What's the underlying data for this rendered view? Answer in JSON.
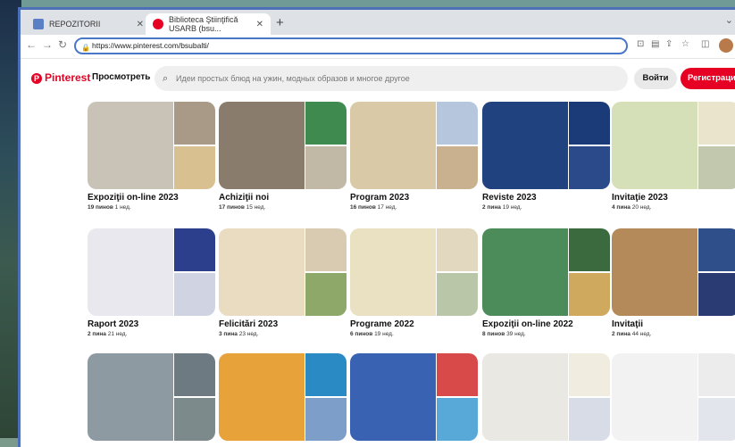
{
  "browser": {
    "tabs": [
      {
        "label": "REPOZITORII",
        "active": false
      },
      {
        "label": "Biblioteca Ştiinţifică USARB (bsu...",
        "active": true
      }
    ],
    "new_tab": "+",
    "window_control": "⌄",
    "url": "https://www.pinterest.com/bsubalti/"
  },
  "pinterest": {
    "logo_text": "Pinterest",
    "view_label": "Просмотреть",
    "search_placeholder": "Идеи простых блюд на ужин, модных образов и многое другое",
    "login_label": "Войти",
    "signup_label": "Регистрация"
  },
  "boards": [
    {
      "title": "Expoziţii on-line 2023",
      "pins": "19 пинов",
      "age": "1 нед.",
      "colors": [
        "#c9c2b6",
        "#a89a86",
        "#d8c090"
      ]
    },
    {
      "title": "Achiziţii noi",
      "pins": "17 пинов",
      "age": "15 нед.",
      "colors": [
        "#8a7c6c",
        "#3f8a4e",
        "#c2b8a6"
      ]
    },
    {
      "title": "Program 2023",
      "pins": "16 пинов",
      "age": "17 нед.",
      "colors": [
        "#d9c9a6",
        "#b6c6dc",
        "#c9b08e"
      ]
    },
    {
      "title": "Reviste 2023",
      "pins": "2 пина",
      "age": "19 нед.",
      "colors": [
        "#20427f",
        "#1b3a78",
        "#2a4a8a"
      ]
    },
    {
      "title": "Invitaţie 2023",
      "pins": "4 пина",
      "age": "20 нед.",
      "colors": [
        "#d6e0b8",
        "#ebe4cc",
        "#c2c8ae"
      ]
    },
    {
      "title": "Raport 2023",
      "pins": "2 пина",
      "age": "21 нед.",
      "colors": [
        "#e8e8ee",
        "#2c3f8c",
        "#d0d4e2"
      ]
    },
    {
      "title": "Felicitări 2023",
      "pins": "3 пина",
      "age": "23 нед.",
      "colors": [
        "#e9dcc0",
        "#d8cbb2",
        "#8ea86a"
      ]
    },
    {
      "title": "Programe 2022",
      "pins": "6 пинов",
      "age": "19 нед.",
      "colors": [
        "#eae0c2",
        "#e2d8c0",
        "#b9c6a8"
      ]
    },
    {
      "title": "Expoziţii on-line 2022",
      "pins": "8 пинов",
      "age": "39 нед.",
      "colors": [
        "#4c8c5a",
        "#3a6a3e",
        "#cfa95e"
      ]
    },
    {
      "title": "Invitaţii",
      "pins": "2 пина",
      "age": "44 нед.",
      "colors": [
        "#b58a5a",
        "#2f4f8a",
        "#2a3a72"
      ]
    },
    {
      "title": "",
      "pins": "",
      "age": "",
      "colors": [
        "#8e9aa2",
        "#6e7a82",
        "#7c8a8c"
      ]
    },
    {
      "title": "",
      "pins": "",
      "age": "",
      "colors": [
        "#e8a23a",
        "#2a8ac4",
        "#7c9ec8"
      ]
    },
    {
      "title": "",
      "pins": "",
      "age": "",
      "colors": [
        "#3a62b2",
        "#d84a4a",
        "#58a8d8"
      ]
    },
    {
      "title": "",
      "pins": "",
      "age": "",
      "colors": [
        "#eae8e2",
        "#f0ece0",
        "#d8dce6"
      ]
    },
    {
      "title": "",
      "pins": "",
      "age": "",
      "colors": [
        "#f2f2f2",
        "#ececec",
        "#e2e6ec"
      ]
    }
  ]
}
